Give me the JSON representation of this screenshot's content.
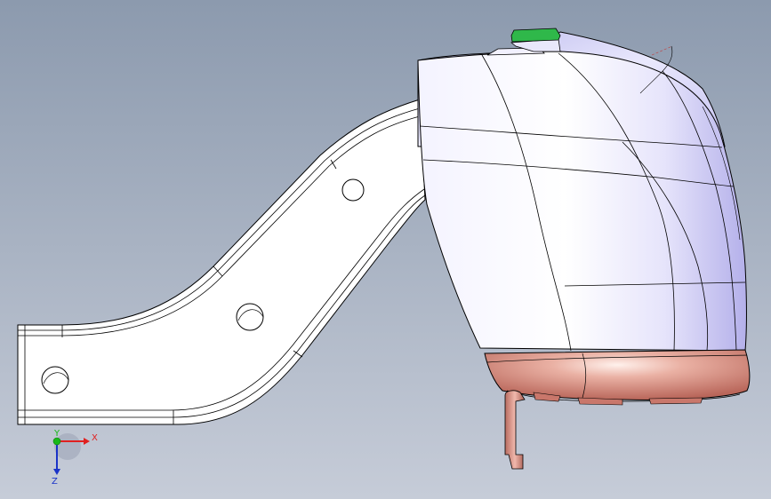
{
  "viewport": {
    "background_top": "#8c9aae",
    "background_bottom": "#c6ccd8"
  },
  "model": {
    "bracket_color": "#ffffff",
    "housing_color": "#f0efff",
    "housing_shade": "#b9b6ee",
    "base_color": "#d98a7e",
    "base_highlight": "#ffe8e2",
    "tab_color": "#2fb84a",
    "pin_color": "#c97f72",
    "edge_color": "#000000"
  },
  "triad": {
    "x_label": "X",
    "y_label": "Y",
    "z_label": "Z",
    "x_color": "#e02020",
    "y_color": "#18b818",
    "z_color": "#1a33c8"
  }
}
